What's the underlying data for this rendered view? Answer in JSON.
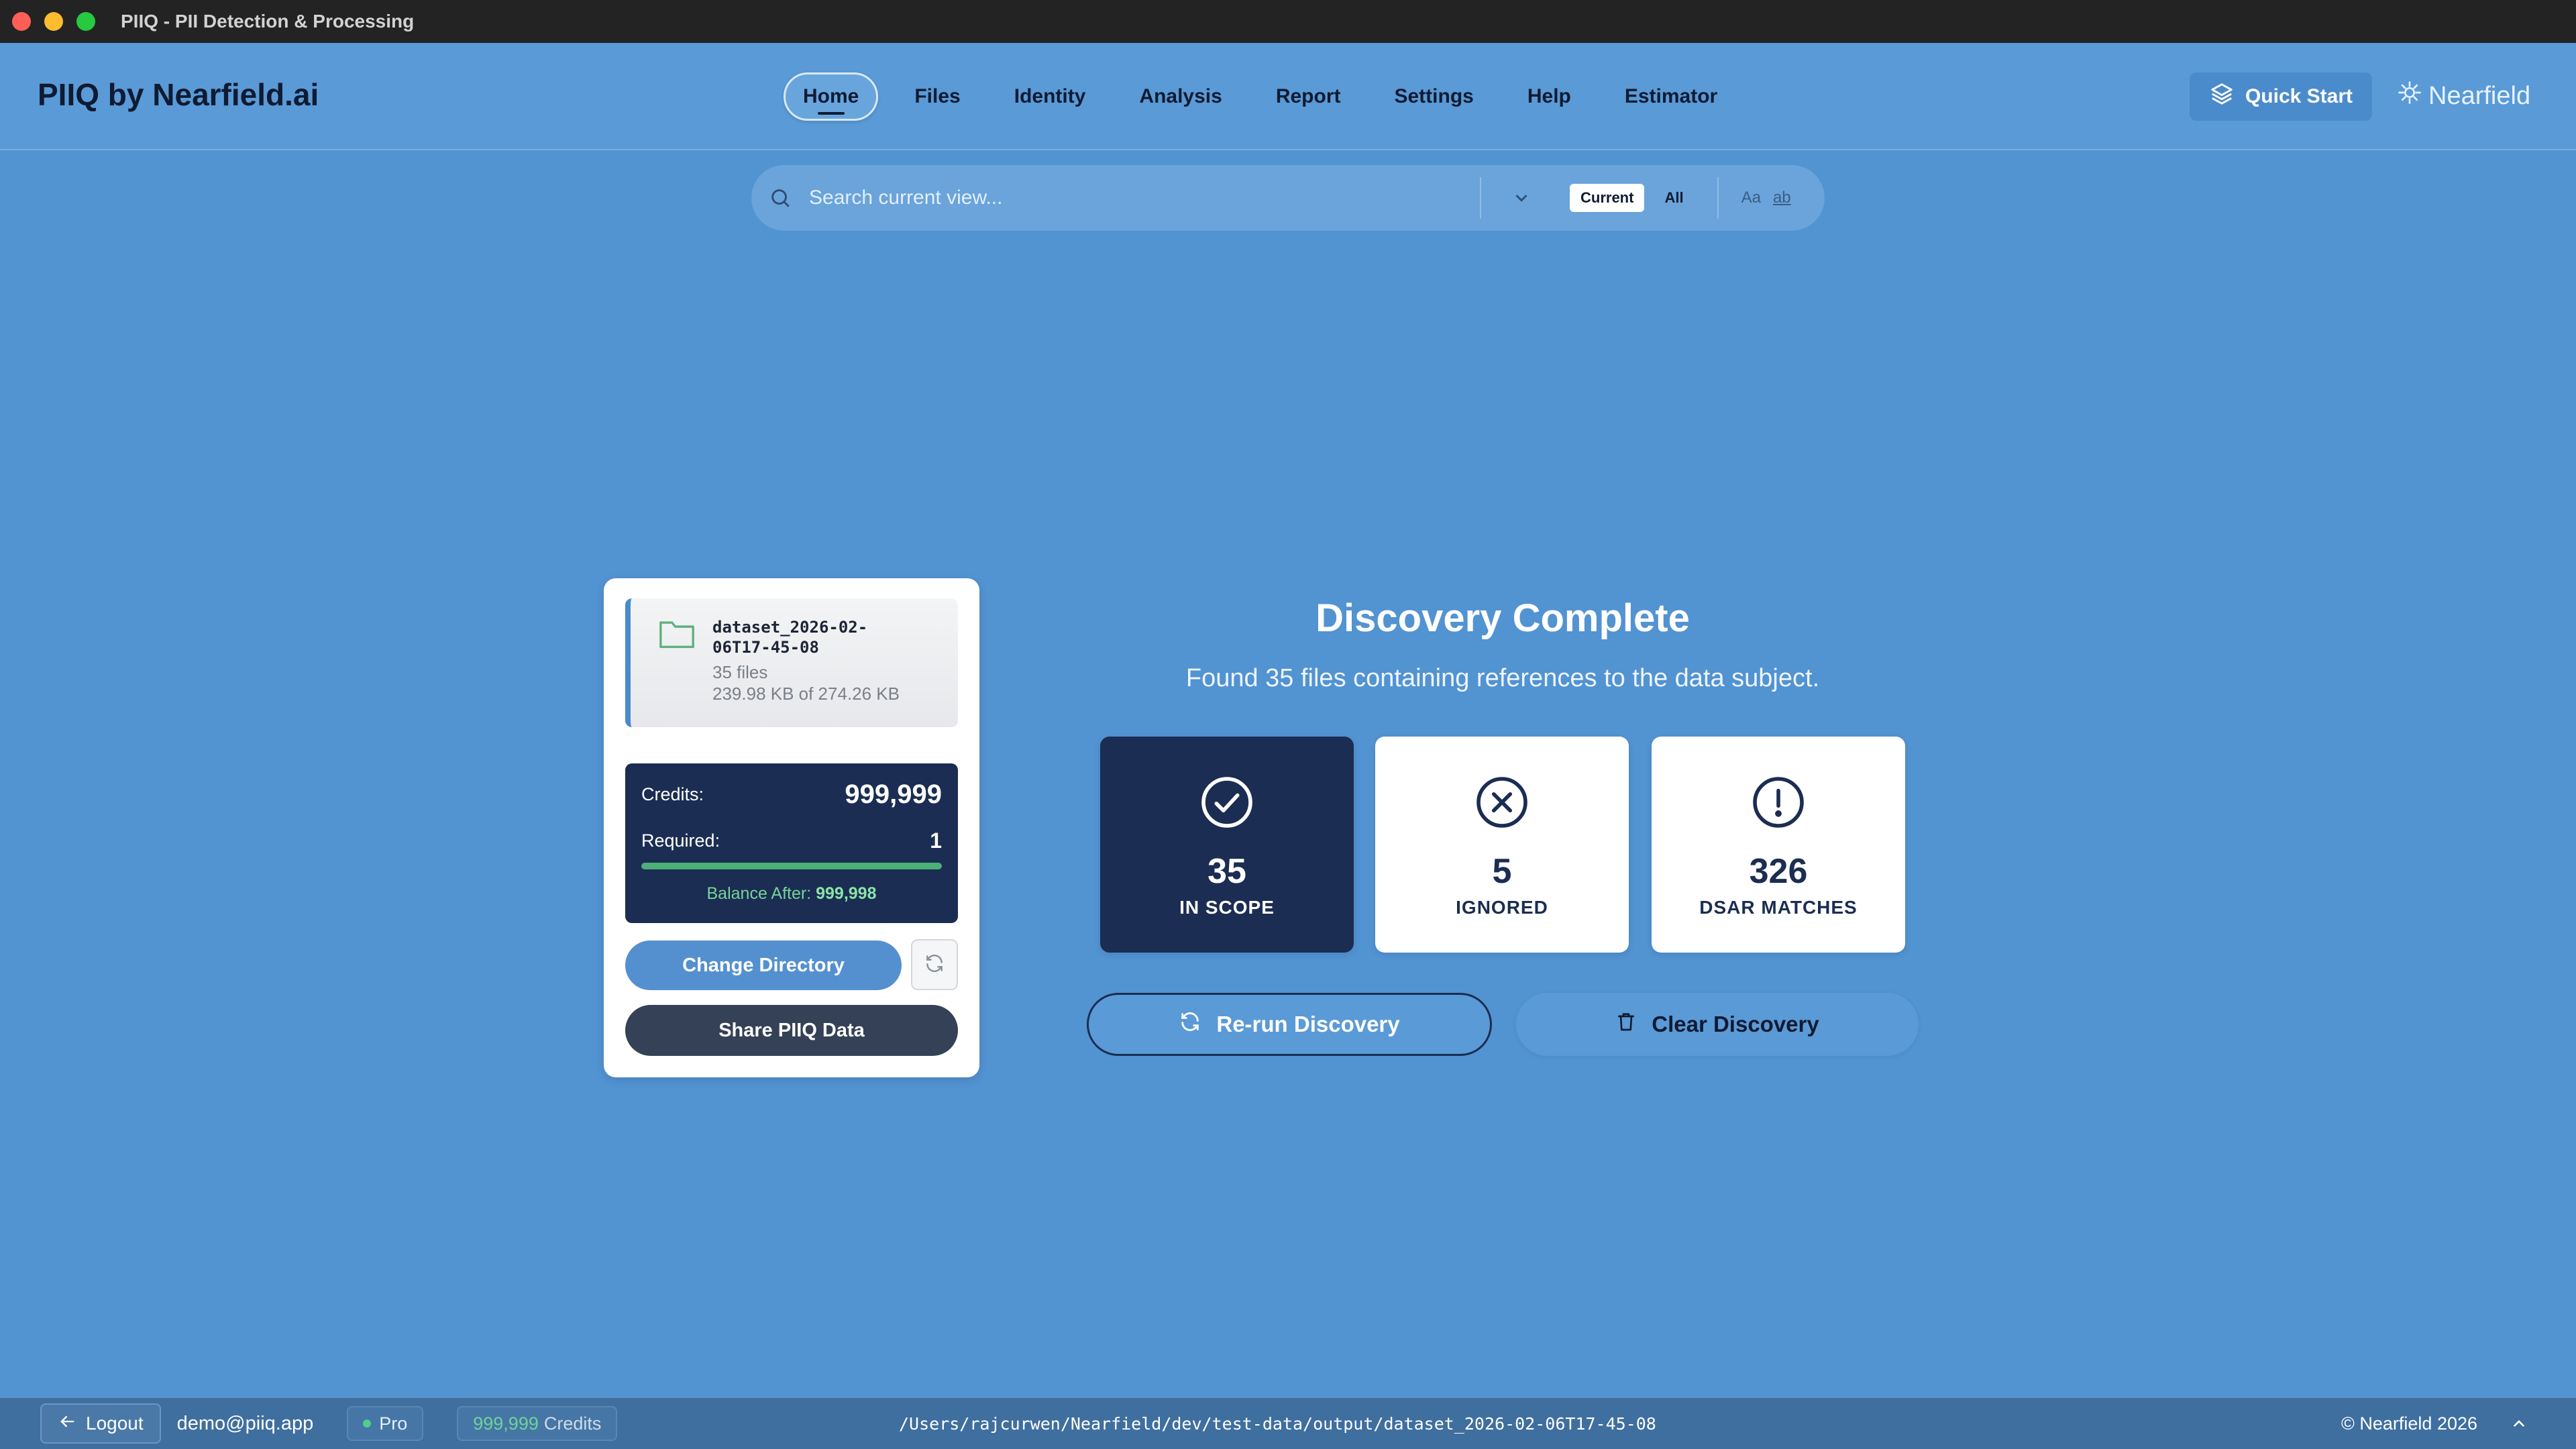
{
  "window": {
    "title": "PIIQ - PII Detection & Processing"
  },
  "header": {
    "brand": "PIIQ by Nearfield.ai",
    "nav": [
      {
        "label": "Home",
        "active": true
      },
      {
        "label": "Files"
      },
      {
        "label": "Identity"
      },
      {
        "label": "Analysis"
      },
      {
        "label": "Report"
      },
      {
        "label": "Settings"
      },
      {
        "label": "Help"
      },
      {
        "label": "Estimator"
      }
    ],
    "quick_start_label": "Quick Start",
    "quick_start_icon": "layers-icon",
    "logo_text": "Nearfield",
    "logo_icon": "sparkle-icon"
  },
  "search": {
    "placeholder": "Search current view...",
    "scope_options": [
      "Current",
      "All"
    ],
    "selected_scope": "Current",
    "match_case_label": "Aa",
    "whole_word_label": "ab"
  },
  "directory_card": {
    "folder_name": "dataset_2026-02-06T17-45-08",
    "file_count": "35 files",
    "size_text": "239.98 KB of 274.26 KB",
    "credits_label": "Credits:",
    "credits_value": "999,999",
    "required_label": "Required:",
    "required_value": "1",
    "required_fill": 1.0,
    "balance_label": "Balance After:",
    "balance_value": "999,998",
    "change_directory_label": "Change Directory",
    "share_label": "Share PIIQ Data"
  },
  "discovery": {
    "title": "Discovery Complete",
    "subtitle": "Found 35 files containing references to the data subject.",
    "stats": [
      {
        "value": "35",
        "label": "IN SCOPE",
        "icon": "check-circle-icon"
      },
      {
        "value": "5",
        "label": "IGNORED",
        "icon": "x-circle-icon"
      },
      {
        "value": "326",
        "label": "DSAR MATCHES",
        "icon": "alert-circle-icon"
      }
    ],
    "rerun_label": "Re-run Discovery",
    "clear_label": "Clear Discovery"
  },
  "statusbar": {
    "logout_label": "Logout",
    "email": "demo@piiq.app",
    "plan": "Pro",
    "credits_amount": "999,999",
    "credits_label": "Credits",
    "path": "/Users/rajcurwen/Nearfield/dev/test-data/output/dataset_2026-02-06T17-45-08",
    "copyright": "© Nearfield 2026"
  },
  "colors": {
    "background": "#5293d2",
    "dark_navy": "#1b2d52",
    "accent_green": "#4caf78"
  }
}
